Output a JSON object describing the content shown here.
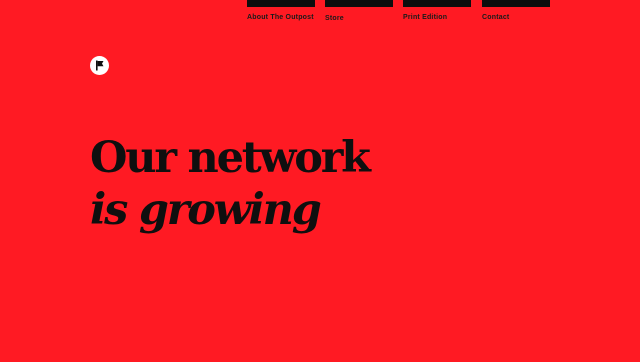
{
  "nav": {
    "items": [
      {
        "label": "About The Outpost"
      },
      {
        "label": "Store"
      },
      {
        "label": "Print Edition"
      },
      {
        "label": "Contact"
      }
    ]
  },
  "logo": {
    "icon": "flag-icon"
  },
  "hero": {
    "line1": "Our network",
    "line2": "is growing"
  },
  "colors": {
    "background": "#ff1a23",
    "text": "#0f0f0f",
    "nav_bar": "#0d0d0d",
    "logo_bg": "#ffffff"
  }
}
